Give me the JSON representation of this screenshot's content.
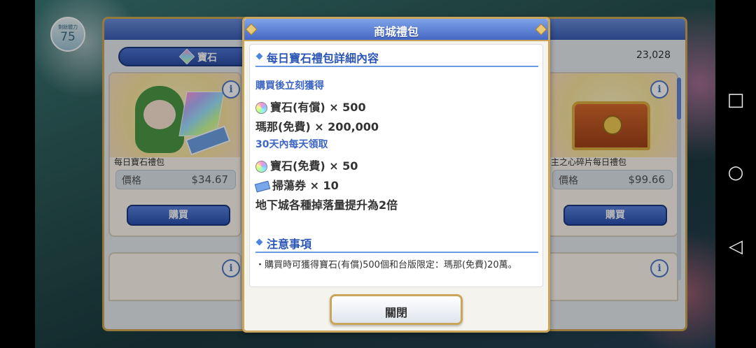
{
  "background": {
    "stamina_label": "剩餘體力",
    "stamina_value": "75",
    "shop_tab_label": "寶石",
    "gem_count": "23,028",
    "cards": [
      {
        "title": "每日寶石禮包",
        "price_label": "價格",
        "price": "$34.67",
        "buy_label": "購買"
      },
      {
        "title": "主之心碎片每日禮包",
        "price_label": "價格",
        "price": "$99.66",
        "buy_label": "購買"
      }
    ]
  },
  "modal": {
    "title": "商城禮包",
    "section1_title": "每日寶石禮包詳細內容",
    "sub1": "購買後立刻獲得",
    "items_immediate": [
      "寶石(有償) × 500",
      "瑪那(免費) × 200,000"
    ],
    "sub2": "30天內每天領取",
    "items_daily": [
      "寶石(免費) × 50",
      "掃蕩券 × 10"
    ],
    "bonus_line": "地下城各種掉落量提升為2倍",
    "section2_title": "注意事項",
    "note_text": "・購買時可獲得寶石(有償)500個和台版限定：瑪那(免費)20萬。",
    "close_label": "關閉"
  },
  "system_nav": {
    "icons": [
      "square-icon",
      "circle-icon",
      "back-triangle-icon"
    ]
  }
}
